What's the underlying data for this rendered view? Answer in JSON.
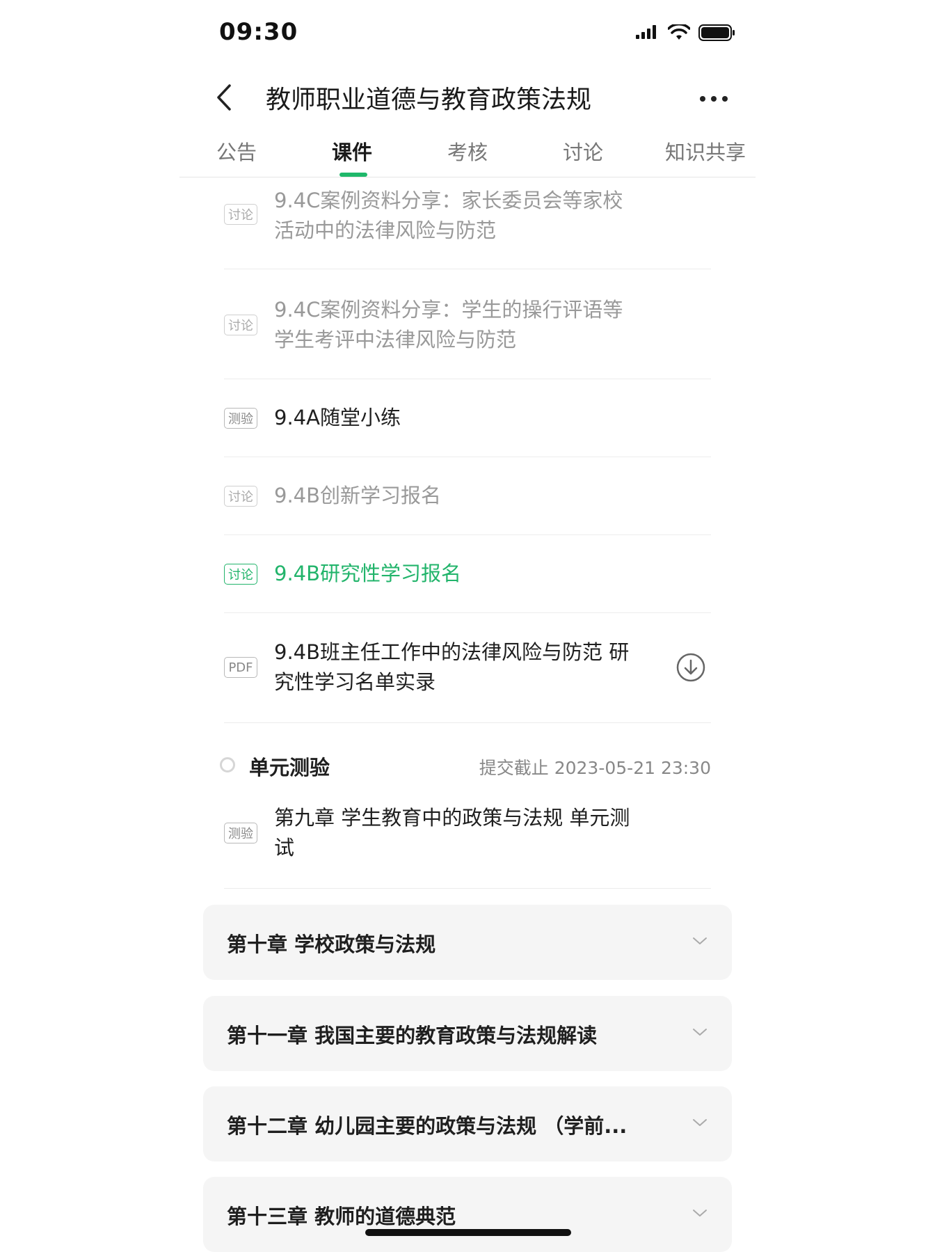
{
  "status_bar": {
    "time": "09:30"
  },
  "nav": {
    "title": "教师职业道德与教育政策法规"
  },
  "tabs": [
    {
      "label": "公告"
    },
    {
      "label": "课件"
    },
    {
      "label": "考核"
    },
    {
      "label": "讨论"
    },
    {
      "label": "知识共享"
    }
  ],
  "active_tab": "课件",
  "items": [
    {
      "tag": "讨论",
      "title": "9.4C案例资料分享：家长委员会等家校活动中的法律风险与防范",
      "state": "dim"
    },
    {
      "tag": "讨论",
      "title": "9.4C案例资料分享：学生的操行评语等学生考评中法律风险与防范",
      "state": "dim"
    },
    {
      "tag": "测验",
      "title": "9.4A随堂小练",
      "state": "normal"
    },
    {
      "tag": "讨论",
      "title": "9.4B创新学习报名",
      "state": "dim"
    },
    {
      "tag": "讨论",
      "title": "9.4B研究性学习报名",
      "state": "active"
    },
    {
      "tag": "PDF",
      "title": "9.4B班主任工作中的法律风险与防范 研究性学习名单实录",
      "state": "normal",
      "download": true
    }
  ],
  "unit_test": {
    "label": "单元测验",
    "deadline": "提交截止 2023-05-21 23:30",
    "item": {
      "tag": "测验",
      "title": "第九章 学生教育中的政策与法规 单元测试"
    }
  },
  "chapters": [
    {
      "title": "第十章 学校政策与法规"
    },
    {
      "title": "第十一章 我国主要的教育政策与法规解读"
    },
    {
      "title": "第十二章  幼儿园主要的政策与法规 （学前..."
    },
    {
      "title": "第十三章  教师的道德典范"
    }
  ],
  "colors": {
    "accent": "#22b46b",
    "text": "#1f1f1f",
    "muted": "#999999",
    "card_bg": "#f5f5f5"
  }
}
